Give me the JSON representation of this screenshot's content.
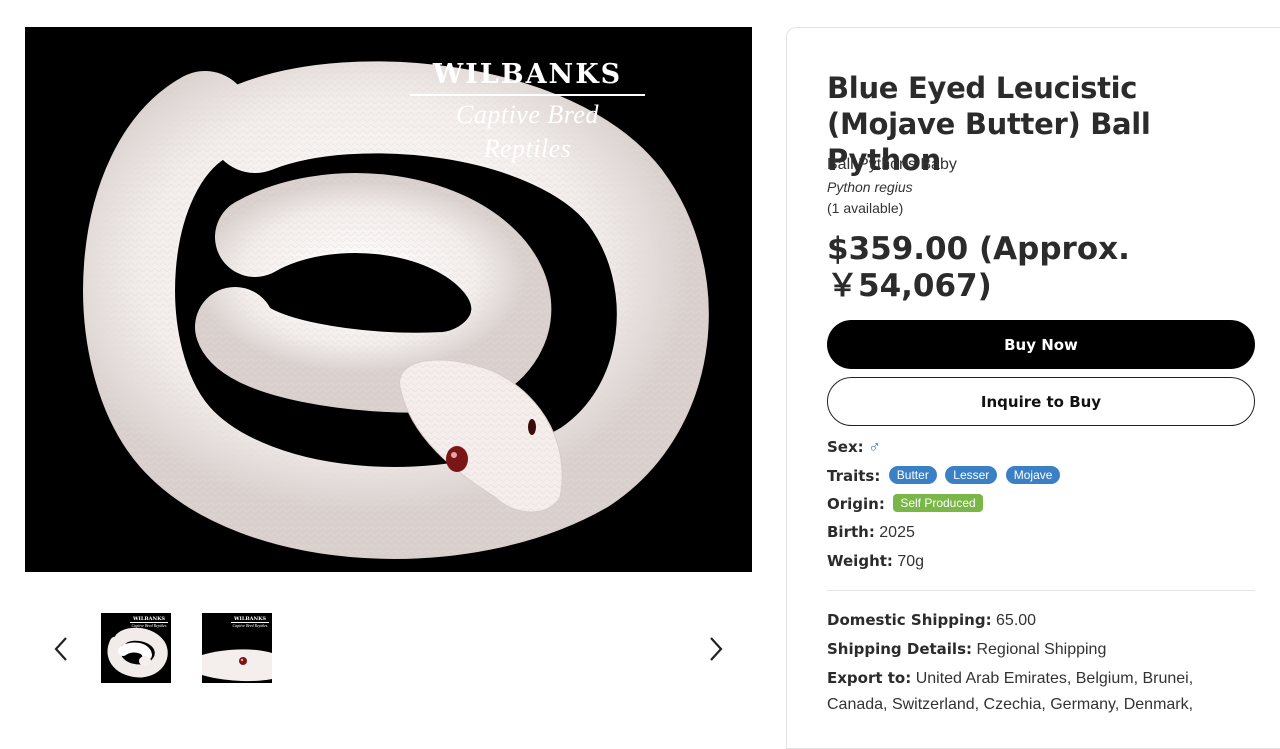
{
  "gallery": {
    "brand_name": "WILBANKS",
    "brand_subtitle": "Captive Bred Reptiles",
    "prev_icon": "chevron-left-icon",
    "next_icon": "chevron-right-icon",
    "thumbnails": 2
  },
  "product": {
    "title": "Blue Eyed Leucistic (Mojave Butter) Ball Python",
    "category": "Ball Pythons Baby",
    "scientific_name": "Python regius",
    "availability": "(1 available)",
    "price": "$359.00 (Approx. ￥54,067)",
    "buy_now_label": "Buy Now",
    "inquire_label": "Inquire to Buy"
  },
  "attributes": {
    "sex_label": "Sex:",
    "sex_value": "♂",
    "traits_label": "Traits:",
    "traits": [
      "Butter",
      "Lesser",
      "Mojave"
    ],
    "origin_label": "Origin:",
    "origin_value": "Self Produced",
    "birth_label": "Birth:",
    "birth_value": "2025",
    "weight_label": "Weight:",
    "weight_value": "70g"
  },
  "shipping": {
    "domestic_label": "Domestic Shipping:",
    "domestic_value": "65.00",
    "details_label": "Shipping Details:",
    "details_value": "Regional Shipping",
    "export_label": "Export to:",
    "export_value": "United Arab Emirates, Belgium, Brunei, Canada, Switzerland, Czechia, Germany, Denmark,"
  },
  "colors": {
    "tag_blue": "#3b7fc4",
    "tag_green": "#7ab648",
    "sex_icon": "#3d7dc4",
    "button_dark": "#000000"
  }
}
